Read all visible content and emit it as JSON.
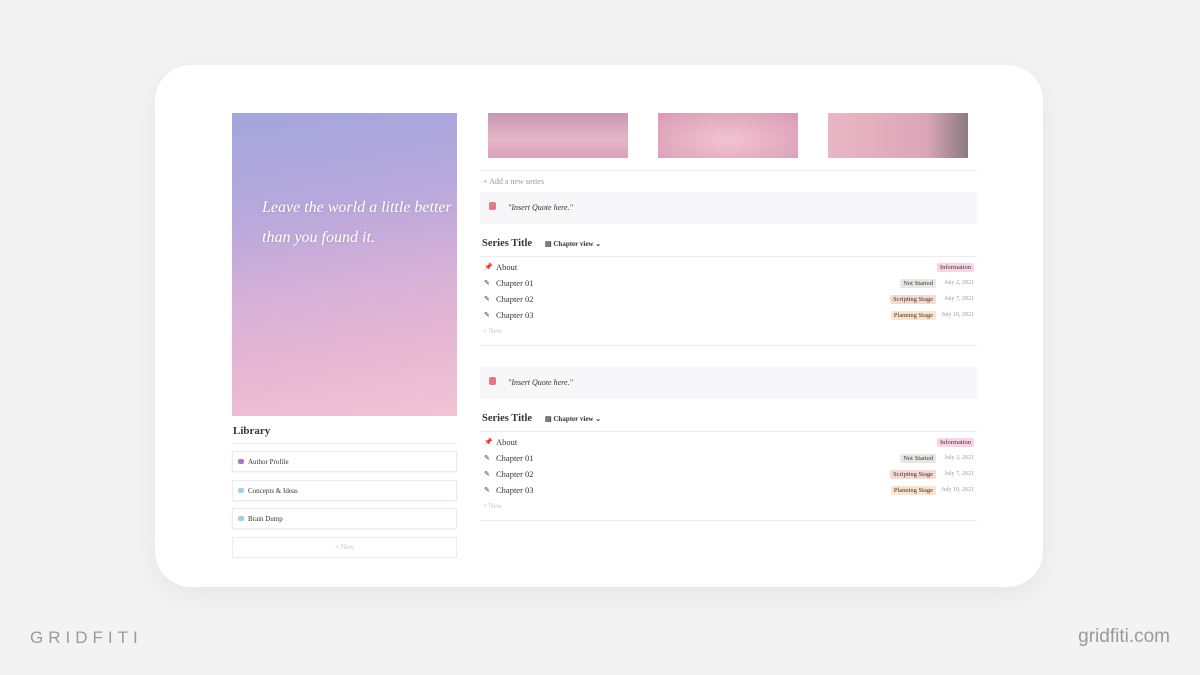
{
  "hero": {
    "quote": "Leave the world a little better than you found it."
  },
  "add_series": "+ Add a new series",
  "library": {
    "title": "Library",
    "items": [
      {
        "label": "Author Profile",
        "color": "#a877c8"
      },
      {
        "label": "Concepts & Ideas",
        "color": "#9ed0e6"
      },
      {
        "label": "Brain Dump",
        "color": "#9ed0e6"
      }
    ],
    "new": "+ New"
  },
  "sections": [
    {
      "quote": "\"Insert Quote here.\"",
      "title": "Series Title",
      "view": "Chapter view ⌄",
      "rows": [
        {
          "icon": "pin",
          "label": "About",
          "tag": "Information",
          "tag_color": "#f9d4e6",
          "date": ""
        },
        {
          "icon": "pencil",
          "label": "Chapter 01",
          "tag": "Not Started",
          "tag_color": "#e8e7e4",
          "date": "July 2, 2021"
        },
        {
          "icon": "pencil",
          "label": "Chapter 02",
          "tag": "Scripting Stage",
          "tag_color": "#f8d9d2",
          "date": "July 7, 2021"
        },
        {
          "icon": "pencil",
          "label": "Chapter 03",
          "tag": "Planning Stage",
          "tag_color": "#fbe4cb",
          "date": "July 10, 2021"
        }
      ],
      "new": "+ New"
    },
    {
      "quote": "\"Insert Quote here.\"",
      "title": "Series Title",
      "view": "Chapter view ⌄",
      "rows": [
        {
          "icon": "pin",
          "label": "About",
          "tag": "Information",
          "tag_color": "#f9d4e6",
          "date": ""
        },
        {
          "icon": "pencil",
          "label": "Chapter 01",
          "tag": "Not Started",
          "tag_color": "#e8e7e4",
          "date": "July 2, 2021"
        },
        {
          "icon": "pencil",
          "label": "Chapter 02",
          "tag": "Scripting Stage",
          "tag_color": "#f8d9d2",
          "date": "July 7, 2021"
        },
        {
          "icon": "pencil",
          "label": "Chapter 03",
          "tag": "Planning Stage",
          "tag_color": "#fbe4cb",
          "date": "July 10, 2021"
        }
      ],
      "new": "+ New"
    }
  ],
  "footer": {
    "brand": "GRIDFITI",
    "site": "gridfiti.com"
  }
}
